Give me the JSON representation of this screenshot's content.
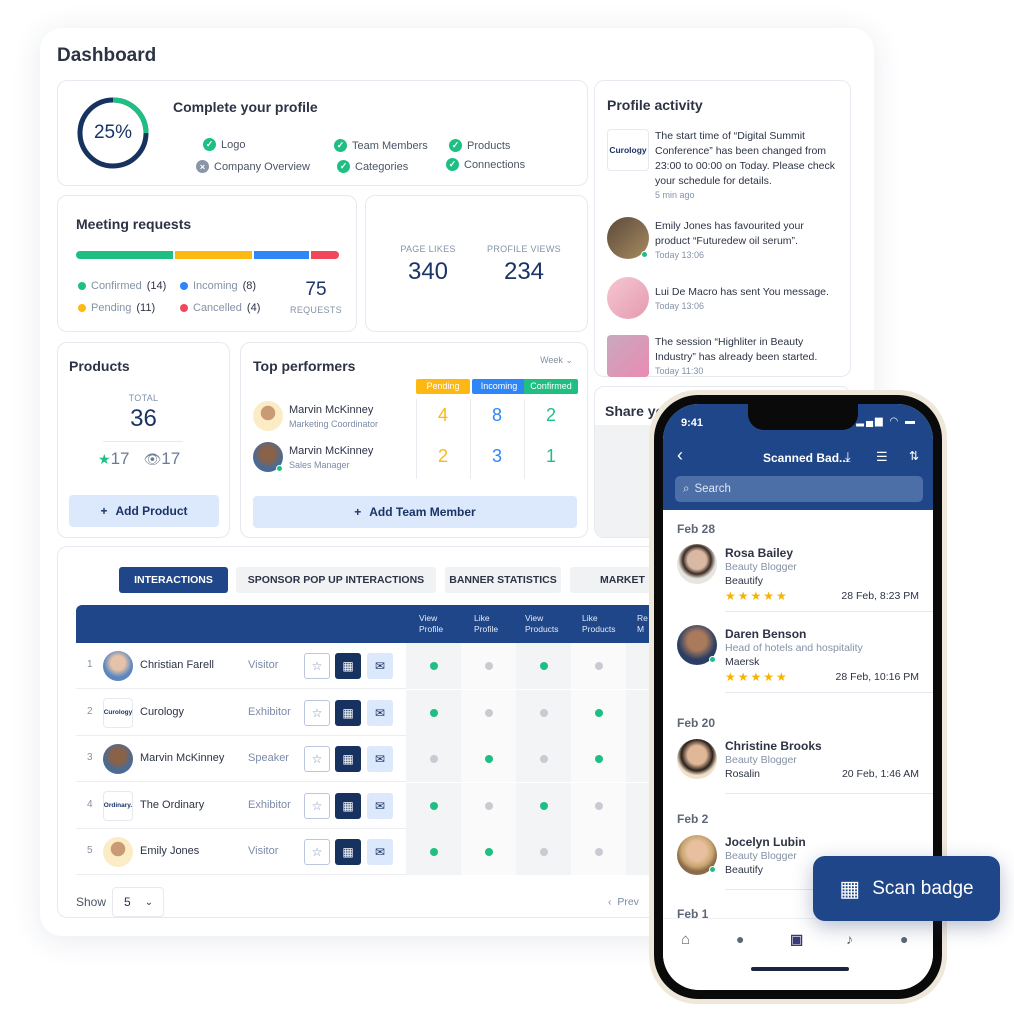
{
  "dashboard": {
    "title": "Dashboard"
  },
  "profile": {
    "title": "Complete your profile",
    "progress_percent": 25,
    "progress_label": "25%",
    "items": [
      {
        "label": "Logo",
        "done": true
      },
      {
        "label": "Company Overview",
        "done": false
      },
      {
        "label": "Team Members",
        "done": true
      },
      {
        "label": "Categories",
        "done": true
      },
      {
        "label": "Products",
        "done": true
      },
      {
        "label": "Connections",
        "done": true
      }
    ]
  },
  "meetings": {
    "title": "Meeting requests",
    "legend": [
      {
        "label": "Confirmed",
        "count": "(14)",
        "value": 14,
        "color": "#1fbf83"
      },
      {
        "label": "Pending",
        "count": "(11)",
        "value": 11,
        "color": "#fdb813"
      },
      {
        "label": "Incoming",
        "count": "(8)",
        "value": 8,
        "color": "#2f86f6"
      },
      {
        "label": "Cancelled",
        "count": "(4)",
        "value": 4,
        "color": "#f2475a"
      }
    ],
    "total": "75",
    "total_label": "REQUESTS"
  },
  "stats": {
    "likes_label": "PAGE LIKES",
    "likes": "340",
    "views_label": "PROFILE VIEWS",
    "views": "234"
  },
  "activity": {
    "title": "Profile activity",
    "items": [
      {
        "text": "The start time of “Digital Summit Conference” has been changed from 23:00 to 00:00 on Today. Please check your schedule for details.",
        "time": "5 min ago",
        "logo": "Curology"
      },
      {
        "text": "Emily Jones has favourited your product “Futuredew oil serum”.",
        "time": "Today 13:06"
      },
      {
        "text": "Lui De Macro has sent You message.",
        "time": "Today 13:06"
      },
      {
        "text": "The session “Highliter in Beauty Industry” has already been started.",
        "time": "Today 11:30"
      }
    ]
  },
  "share": {
    "title": "Share your"
  },
  "products": {
    "title": "Products",
    "total_label": "TOTAL",
    "total": "36",
    "stars": "17",
    "views": "17",
    "add_label": "Add Product"
  },
  "performers": {
    "title": "Top performers",
    "period": "Week",
    "columns": [
      "Pending",
      "Incoming",
      "Confirmed"
    ],
    "rows": [
      {
        "name": "Marvin McKinney",
        "role": "Marketing Coordinator",
        "values": [
          "4",
          "8",
          "2"
        ]
      },
      {
        "name": "Marvin McKinney",
        "role": "Sales Manager",
        "values": [
          "2",
          "3",
          "1"
        ]
      }
    ],
    "add_label": "Add Team Member"
  },
  "interactions": {
    "tabs": [
      "INTERACTIONS",
      "SPONSOR POP UP INTERACTIONS",
      "BANNER STATISTICS",
      "MARKET"
    ],
    "columns": [
      "View Profile",
      "Like Profile",
      "View Products",
      "Like Products",
      "Re M"
    ],
    "rows": [
      {
        "n": "1",
        "name": "Christian Farell",
        "role": "Visitor",
        "flags": [
          true,
          false,
          true,
          false
        ]
      },
      {
        "n": "2",
        "name": "Curology",
        "role": "Exhibitor",
        "logo": "Curology",
        "flags": [
          true,
          false,
          false,
          true
        ]
      },
      {
        "n": "3",
        "name": "Marvin McKinney",
        "role": "Speaker",
        "flags": [
          false,
          true,
          false,
          true
        ]
      },
      {
        "n": "4",
        "name": "The Ordinary",
        "role": "Exhibitor",
        "logo": "Ordinary.",
        "flags": [
          true,
          false,
          true,
          false
        ]
      },
      {
        "n": "5",
        "name": "Emily Jones",
        "role": "Visitor",
        "flags": [
          true,
          true,
          false,
          false
        ]
      }
    ],
    "show_label": "Show",
    "page_size": "5",
    "prev_label": "Prev"
  },
  "phone": {
    "time": "9:41",
    "title": "Scanned Bad...",
    "search_placeholder": "Search",
    "sections": [
      {
        "date": "Feb 28",
        "people": [
          {
            "name": "Rosa Bailey",
            "title": "Beauty Blogger",
            "company": "Beautify",
            "rating": 5,
            "when": "28 Feb, 8:23 PM"
          },
          {
            "name": "Daren Benson",
            "title": "Head of hotels and hospitality",
            "company": "Maersk",
            "rating": 5,
            "when": "28 Feb, 10:16 PM"
          }
        ]
      },
      {
        "date": "Feb 20",
        "people": [
          {
            "name": "Christine Brooks",
            "title": "Beauty Blogger",
            "company": "Rosalin",
            "when": "20 Feb, 1:46 AM"
          }
        ]
      },
      {
        "date": "Feb 2",
        "people": [
          {
            "name": "Jocelyn Lubin",
            "title": "Beauty Blogger",
            "company": "Beautify"
          }
        ]
      },
      {
        "date": "Feb 1",
        "people": []
      }
    ],
    "stars": "★★★★★"
  },
  "scan_button": {
    "label": "Scan badge"
  }
}
